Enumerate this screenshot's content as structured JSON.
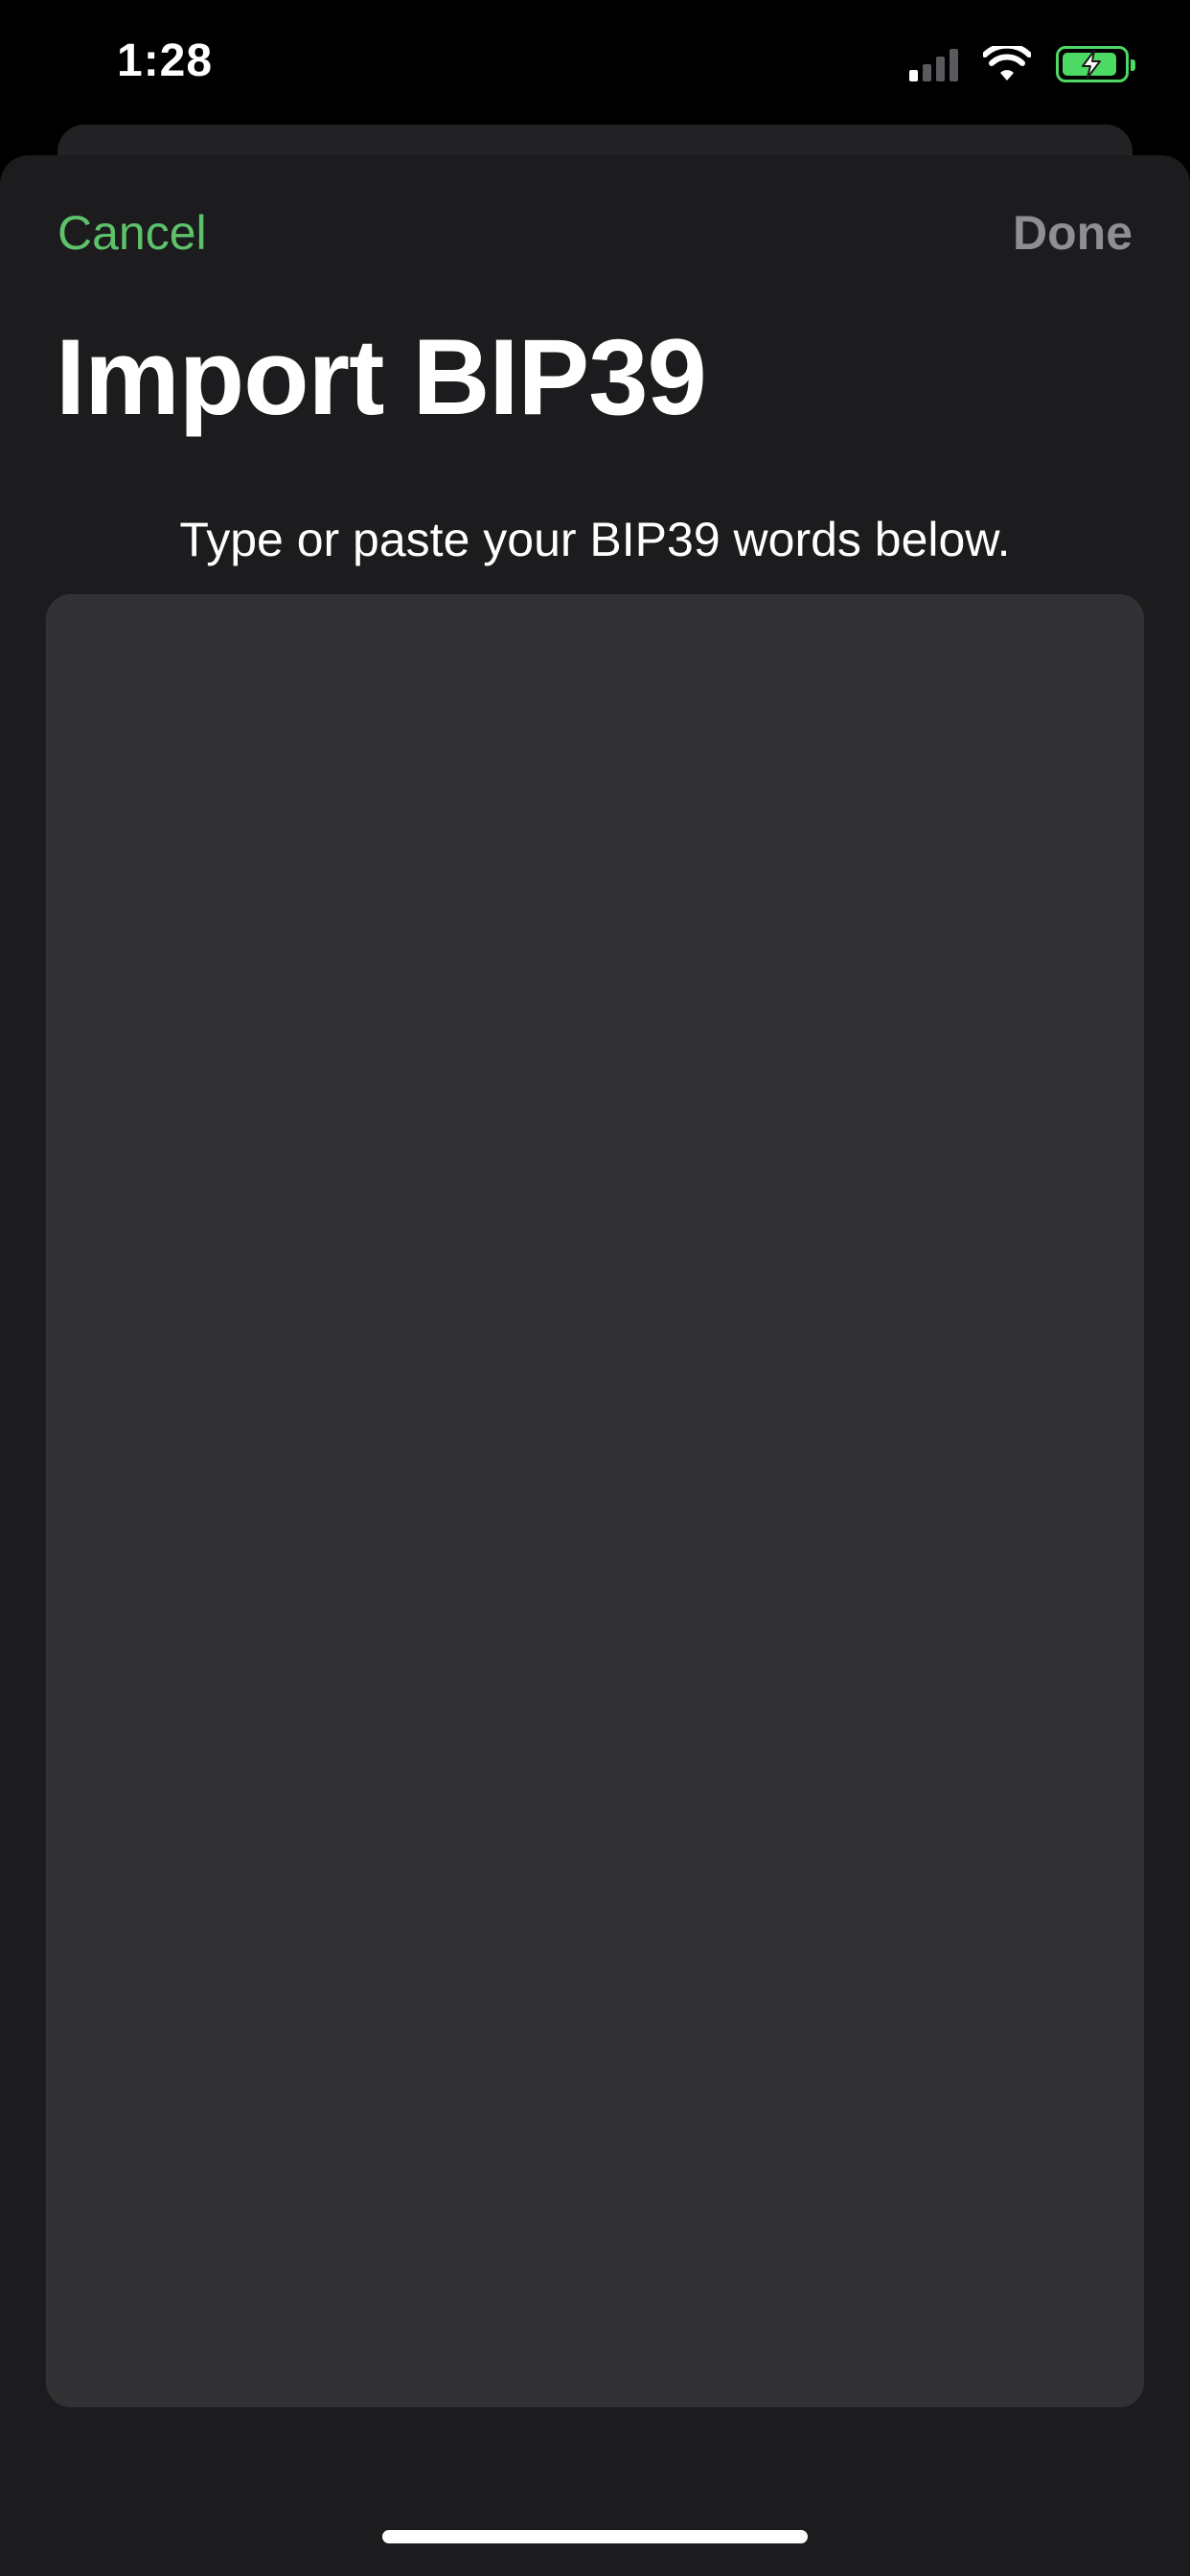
{
  "status_bar": {
    "time": "1:28",
    "icons": [
      "signal-icon",
      "wifi-icon",
      "battery-charging-icon"
    ],
    "battery_color": "#4cd964"
  },
  "nav": {
    "cancel_label": "Cancel",
    "done_label": "Done",
    "cancel_color": "#5ec26a",
    "done_color": "#8e8e93"
  },
  "page": {
    "title": "Import BIP39",
    "instruction": "Type or paste your BIP39 words below.",
    "words_value": ""
  }
}
